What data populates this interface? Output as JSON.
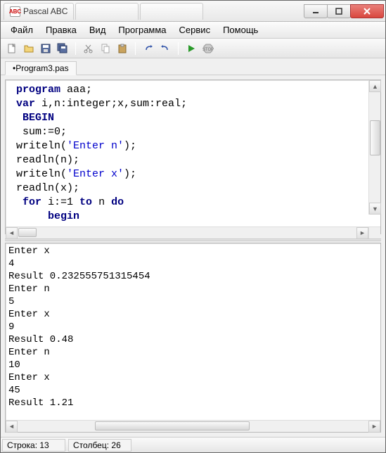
{
  "titlebar": {
    "app_title": "Pascal ABC",
    "tabs": [
      "Pascal ABC",
      "",
      ""
    ],
    "app_icon_text": "ABC"
  },
  "menubar": {
    "items": [
      "Файл",
      "Правка",
      "Вид",
      "Программа",
      "Сервис",
      "Помощь"
    ]
  },
  "file_tab": {
    "label": "•Program3.pas"
  },
  "code": {
    "lines": [
      {
        "pre": " ",
        "kw": "program",
        "post": " aaa;"
      },
      {
        "pre": " ",
        "kw": "var",
        "post": " i,n:integer;x,sum:real;"
      },
      {
        "pre": "  ",
        "kw": "BEGIN",
        "post": ""
      },
      {
        "pre": "  sum:=0;",
        "kw": "",
        "post": ""
      },
      {
        "pre": " writeln(",
        "str": "'Enter n'",
        "post": ");"
      },
      {
        "pre": " readln(n);",
        "kw": "",
        "post": ""
      },
      {
        "pre": " writeln(",
        "str": "'Enter x'",
        "post": ");"
      },
      {
        "pre": " readln(x);",
        "kw": "",
        "post": ""
      },
      {
        "pre": "  ",
        "kw": "for",
        "mid": " i:=1 ",
        "kw2": "to",
        "mid2": " n ",
        "kw3": "do",
        "post": ""
      },
      {
        "pre": "      ",
        "kw": "begin",
        "post": ""
      }
    ]
  },
  "output": {
    "text": "Enter x\n4\nResult 0.232555751315454\nEnter n\n5\nEnter x\n9\nResult 0.48\nEnter n\n10\nEnter x\n45\nResult 1.21"
  },
  "statusbar": {
    "row_label": "Строка:",
    "row_value": "13",
    "col_label": "Столбец:",
    "col_value": "26"
  }
}
